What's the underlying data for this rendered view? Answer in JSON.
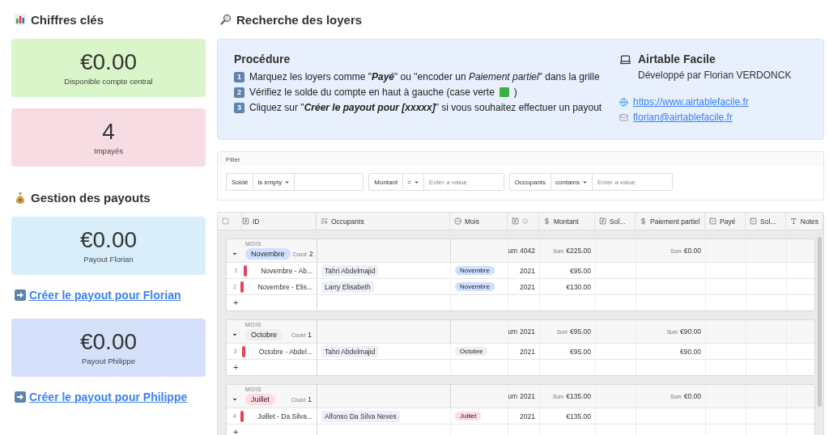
{
  "sidebar": {
    "sections": [
      {
        "kind": "stats",
        "title": "Chiffres clés",
        "items": [
          {
            "kind": "stat",
            "value": "€0.00",
            "label": "Disponible compte central",
            "color": "#d9f5c9"
          },
          {
            "kind": "stat",
            "value": "4",
            "label": "Impayés",
            "color": "#f8dce3"
          }
        ]
      },
      {
        "kind": "payouts",
        "title": "Gestion des payouts",
        "items": [
          {
            "kind": "stat",
            "value": "€0.00",
            "label": "Payout Florian",
            "color": "#d8eefa"
          },
          {
            "kind": "link",
            "text": "Créer le payout pour Florian"
          },
          {
            "kind": "stat",
            "value": "€0.00",
            "label": "Payout Philippe",
            "color": "#d5e0fb"
          },
          {
            "kind": "link",
            "text": "Créer le payout pour Philippe"
          }
        ]
      }
    ]
  },
  "main": {
    "title": "Recherche des loyers",
    "procedure": {
      "title": "Procédure",
      "steps": [
        {
          "number": "1",
          "text": "Marquez les loyers comme \"**Payé**\" ou \"encoder un *Paiement partiel*\" dans la grille"
        },
        {
          "number": "2",
          "text": "Vérifiez le solde du compte en haut à gauche (case verte",
          "square": true,
          "suffix": ")"
        },
        {
          "number": "3",
          "text": "Cliquez sur \"**Créer le payout pour [xxxxx]**\" si vous souhaitez effectuer un payout"
        }
      ]
    },
    "about": {
      "title": "Airtable Facile",
      "subtitle": "Développé par Florian VERDONCK",
      "links": [
        {
          "kind": "web",
          "text": "https://www.airtablefacile.fr"
        },
        {
          "kind": "mail",
          "text": "florian@airtablefacile.fr"
        }
      ]
    }
  },
  "filter": {
    "title": "Filter",
    "conditions": [
      {
        "field": "Soldé",
        "operator": "is empty"
      },
      {
        "field": "Montant",
        "operator": "=",
        "placeholder": "Enter a value"
      },
      {
        "field": "Occupants",
        "operator": "contains",
        "placeholder": "Enter a value"
      }
    ]
  },
  "table": {
    "add_label": "+",
    "select_all": {
      "checked": false
    },
    "columns": [
      {
        "kind": "formula",
        "label": "ID"
      },
      {
        "kind": "lookup",
        "label": "Occupants"
      },
      {
        "kind": "select",
        "label": "Mois"
      },
      {
        "kind": "formula_info"
      },
      {
        "kind": "currency",
        "label": "Montant"
      },
      {
        "kind": "formula",
        "label": "Sol..."
      },
      {
        "kind": "currency",
        "label": "Paiement partiel"
      },
      {
        "kind": "checkbox",
        "label": "Payé"
      },
      {
        "kind": "checkbox",
        "label": "Sol..."
      },
      {
        "kind": "text",
        "label": "Notes"
      }
    ],
    "groups": [
      {
        "field_label": "MOIS",
        "name": "Novembre",
        "color": "#cfdfff",
        "count_label": "Count",
        "count": "2",
        "year_sum": {
          "label": "um",
          "value": "4042"
        },
        "amount_sum": {
          "label": "Sum",
          "value": "€225.00"
        },
        "partial_sum": {
          "label": "Sum",
          "value": "€0.00"
        },
        "rows": [
          {
            "number": "1",
            "id": "Novembre - Ab...",
            "occupant": "Tahri Abdelmajid",
            "month": "Novembre",
            "year": "2021",
            "amount": "€95.00"
          },
          {
            "number": "2",
            "id": "Novembre - Elis...",
            "occupant": "Larry Elisabeth",
            "month": "Novembre",
            "year": "2021",
            "amount": "€130.00"
          }
        ]
      },
      {
        "field_label": "MOIS",
        "name": "Octobre",
        "color": "#eeeeee",
        "count_label": "Count",
        "count": "1",
        "year_sum": {
          "label": "um",
          "value": "2021"
        },
        "amount_sum": {
          "label": "Sum",
          "value": "€95.00"
        },
        "partial_sum": {
          "label": "Sum",
          "value": "€90.00"
        },
        "rows": [
          {
            "number": "3",
            "id": "Octobre - Abdel...",
            "occupant": "Tahri Abdelmajid",
            "month": "Octobre",
            "year": "2021",
            "amount": "€95.00",
            "partial": "€90.00"
          }
        ]
      },
      {
        "field_label": "MOIS",
        "name": "Juillet",
        "color": "#ffdce5",
        "count_label": "Count",
        "count": "1",
        "year_sum": {
          "label": "um",
          "value": "2021"
        },
        "amount_sum": {
          "label": "Sum",
          "value": "€135.00"
        },
        "partial_sum": {
          "label": "Sum",
          "value": "€0.00"
        },
        "rows": [
          {
            "number": "4",
            "id": "Juillet - Da Silva...",
            "occupant": "Alfonso Da Silva Neves",
            "month": "Juillet",
            "year": "2021",
            "amount": "€135.00"
          }
        ]
      }
    ]
  }
}
